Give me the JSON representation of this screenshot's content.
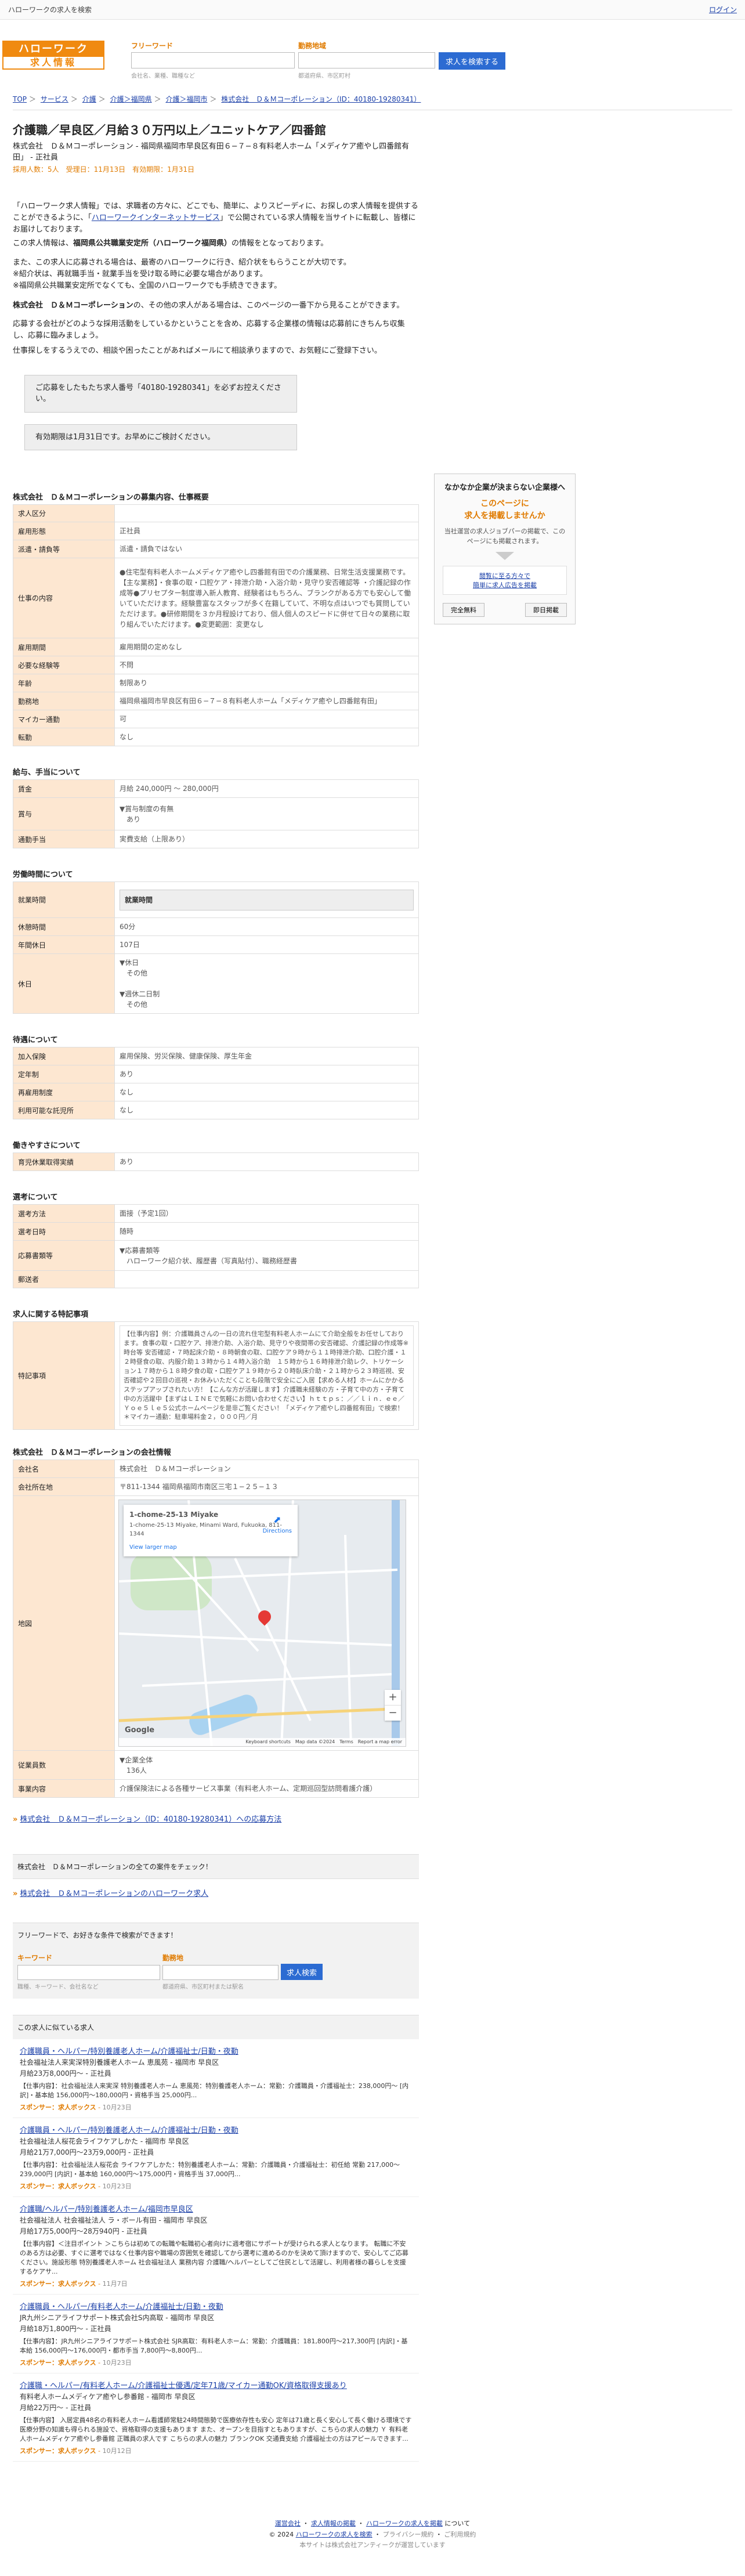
{
  "topbar": {
    "site_title": "ハローワークの求人を検索",
    "login": "ログイン"
  },
  "header": {
    "logo_line1": "ハローワーク",
    "logo_line2": "求人情報",
    "keyword_label": "フリーワード",
    "keyword_hint": "会社名、業種、職種など",
    "area_label": "勤務地域",
    "area_hint": "都道府県、市区町村",
    "search_button": "求人を検索する"
  },
  "breadcrumb": [
    "TOP",
    "サービス",
    "介護",
    "介護＞福岡県",
    "介護＞福岡市",
    "株式会社　Ｄ＆Ｍコーポレーション（ID：40180-19280341）"
  ],
  "job": {
    "title": "介護職／早良区／月給３０万円以上／ユニットケア／四番館",
    "employer_line": "株式会社　Ｄ＆Ｍコーポレーション - 福岡県福岡市早良区有田６−７−８有料老人ホーム「メディケア癒やし四番館有田」 - 正社員",
    "pubinfo": "採用人数：5人　受理日：11月13日　有効期限：1月31日"
  },
  "intro": {
    "p1_a": "「ハローワーク求人情報」では、求職者の方々に、どこでも、簡単に、よりスピーディに、お探しの求人情報を提供することができるように、「",
    "p1_link": "ハローワークインターネットサービス",
    "p1_b": "」で公開されている求人情報を当サイトに転載し、皆様にお届けしております。",
    "p2_a": "この求人情報は、",
    "p2_bold": "福岡県公共職業安定所（ハローワーク福岡県）",
    "p2_b": "の情報をとなっております。",
    "p3": "また、この求人に応募される場合は、最寄のハローワークに行き、紹介状をもらうことが大切です。",
    "p4": "※紹介状は、再就職手当・就業手当を受け取る時に必要な場合があります。",
    "p5": "※福岡県公共職業安定所でなくても、全国のハローワークでも手続きできます。",
    "p6_bold": "株式会社　Ｄ＆Ｍコーポレーション",
    "p6_b": "の、その他の求人がある場合は、このページの一番下から見ることができます。",
    "p7": "応募する会社がどのような採用活動をしているかということを含め、応募する企業様の情報は応募前にきちんち収集し、応募に臨みましょう。",
    "p8": "仕事探しをするうえでの、相談や困ったことがあればメールにて相談承りますので、お気軽にご登録下さい。"
  },
  "notice1": "ご応募をしたもたち求人番号「40180-19280341」を必ずお控えください。",
  "notice2": "有効期限は1月31日です。お早めにご検討ください。",
  "sidebar": {
    "head": "なかなか企業が決まらない企業様へ",
    "orange": "このページに\n求人を掲載しませんか",
    "text": "当社運営の求人ジョブパーの掲載で、このページにも掲載されます。",
    "link": "閲覧に至る方々で\n簡単に求人広告を掲載",
    "btn1": "完全無料",
    "btn2": "即日掲載"
  },
  "sections": {
    "overview": {
      "title": "株式会社　Ｄ＆Ｍコーポレーションの募集内容、仕事概要",
      "rows": [
        {
          "k": "求人区分",
          "v": ""
        },
        {
          "k": "雇用形態",
          "v": "正社員"
        },
        {
          "k": "派遣・請負等",
          "v": "派遣・請負ではない"
        },
        {
          "k": "仕事の内容",
          "v": "●住宅型有料老人ホームメディケア癒やし四番館有田での介護業務、日常生活支援業務です。【主な業務】・食事の取・口腔ケア・排泄介助・入浴介助・見守り安否確認等 ・介護記録の作成等●プリセプター制度導入新人教育、経験者はもちろん、ブランクがある方でも安心して働いていただけます。経験豊富なスタッフが多く在籍していて、不明な点はいつでも質問していただけます。●研修期間を３か月程設けており、個人個人のスピードに併せて日々の業務に取り組んでいただけます。●変更範囲：変更なし"
        },
        {
          "k": "雇用期間",
          "v": "雇用期間の定めなし"
        },
        {
          "k": "必要な経験等",
          "v": "不問"
        },
        {
          "k": "年齢",
          "v": "制限あり"
        },
        {
          "k": "勤務地",
          "v": "福岡県福岡市早良区有田６−７−８有料老人ホーム「メディケア癒やし四番館有田」"
        },
        {
          "k": "マイカー通勤",
          "v": "可"
        },
        {
          "k": "転勤",
          "v": "なし"
        }
      ]
    },
    "salary": {
      "title": "給与、手当について",
      "rows": [
        {
          "k": "賃金",
          "v": "月給 240,000円 〜 280,000円"
        },
        {
          "k": "賞与",
          "v": "▼賞与制度の有無\n　あり"
        },
        {
          "k": "通勤手当",
          "v": "実費支給（上限あり）"
        }
      ]
    },
    "conditions": {
      "title": "労働時間について",
      "rows": [
        {
          "k": "就業時間",
          "v": "就業時間"
        },
        {
          "k": "休憩時間",
          "v": "60分"
        },
        {
          "k": "年間休日",
          "v": "107日"
        },
        {
          "k": "休日",
          "v": "▼休日\n　その他\n\n▼週休二日制\n　その他"
        }
      ]
    },
    "benefits": {
      "title": "待遇について",
      "rows": [
        {
          "k": "加入保険",
          "v": "雇用保険、労災保険、健康保険、厚生年金"
        },
        {
          "k": "定年制",
          "v": "あり"
        },
        {
          "k": "再雇用制度",
          "v": "なし"
        },
        {
          "k": "利用可能な託児所",
          "v": "なし"
        }
      ]
    },
    "ease": {
      "title": "働きやすさについて",
      "rows": [
        {
          "k": "育児休業取得実績",
          "v": "あり"
        }
      ]
    },
    "selection": {
      "title": "選考について",
      "rows": [
        {
          "k": "選考方法",
          "v": "面接（予定1回）"
        },
        {
          "k": "選考日時",
          "v": "随時"
        },
        {
          "k": "応募書類等",
          "v": "▼応募書類等\n　ハローワーク紹介状、履歴書（写真貼付）、職務経歴書"
        },
        {
          "k": "郵送者",
          "v": ""
        }
      ]
    },
    "notes": {
      "title": "求人に関する特記事項",
      "k": "特記事項",
      "v": "【仕事内容】例：介護職員さんの一日の流れ住宅型有料老人ホームにて介助全般をお任せしております。食事の取・口腔ケア、排泄介助、入浴介助、見守りや夜間帯の安否確認、介護記録の作成等※時台等 安否確認・７時起床介助・８時朝食の取、口腔ケア９時から１１時排泄介助、口腔介護・１２時昼食の取、内服介助１３時から１４時入浴介助　１５時から１６時排泄介助レク、トリケーション１７時から１８時夕食の取・口腔ケア１９時から２０時臥床介助・２１時から２３時巡視、安否確認や２回目の巡視・お休みいただくことも段階で安全にご入居【求める人材】ホームにかかるステップアップされたい方！【こんな方が活躍します】介護職未経験の方・子育て中の方・子育て中の方活躍中【まずはＬＩＮＥで気軽にお問い合わせください】ｈｔｔｐｓ：／／ｌｉｎ．ｅｅ／Ｙｏｅ５ｌｅ５公式ホームページを是非ご覧ください！「メディケア癒やし四番館有田」で検索！＊マイカー通勤：駐車場料金２，０００円／月"
    },
    "company": {
      "title": "株式会社　Ｄ＆Ｍコーポレーションの会社情報",
      "rows": [
        {
          "k": "会社名",
          "v": "株式会社　Ｄ＆Ｍコーポレーション"
        },
        {
          "k": "会社所在地",
          "v": "〒811-1344 福岡県福岡市南区三宅１−２５−１３"
        }
      ],
      "map_row": "地図",
      "employees_k": "従業員数",
      "employees_v": "▼企業全体\n　136人",
      "biz_k": "事業内容",
      "biz_v": "介護保険法による各種サービス事業（有料老人ホーム、定期巡回型訪問看護介護）"
    }
  },
  "map": {
    "place_title": "1-chome-25-13 Miyake",
    "place_addr": "1-chome-25-13 Miyake, Minami Ward, Fukuoka, 811-1344",
    "directions": "Directions",
    "larger_map": "View larger map",
    "google": "Google",
    "footer": "Keyboard shortcuts　Map data ©2024　Terms　Report a map error"
  },
  "links": {
    "apply": "株式会社　Ｄ＆Ｍコーポレーション（ID：40180-19280341）への応募方法",
    "check_all": "株式会社　Ｄ＆Ｍコーポレーションの全ての案件をチェック！",
    "hw_jobs": "株式会社　Ｄ＆Ｍコーポレーションのハローワーク求人"
  },
  "freesearch": {
    "head": "フリーワードで、お好きな条件で検索ができます！",
    "kw_label": "キーワード",
    "kw_hint": "職種、キーワード、会社名など",
    "area_label": "勤務地",
    "area_hint": "都道府県、市区町村または駅名",
    "button": "求人検索"
  },
  "recommend": {
    "head": "この求人に似ている求人",
    "sponsor_label": "スポンサー：求人ボックス",
    "items": [
      {
        "title": "介護職員・ヘルパー/特別養護老人ホーム/介護福祉士/日勤・夜勤",
        "company": "社会福祉法人来実深特別養護老人ホーム 恵風苑 - 福岡市 早良区",
        "salary": "月給23万8,000円〜 - 正社員",
        "desc": "【仕事内容】：社会福祉法人来実深 特別養護老人ホーム 恵風苑：特別養護老人ホーム：常勤：介護職員・介護福祉士：238,000円〜 [内訳]・基本給 156,000円〜180,000円・資格手当 25,000円...",
        "date": "10月23日"
      },
      {
        "title": "介護職員・ヘルパー/特別養護老人ホーム/介護福祉士/日勤・夜勤",
        "company": "社会福祉法人桜花会ライフケアしかた - 福岡市 早良区",
        "salary": "月給21万7,000円〜23万9,000円 - 正社員",
        "desc": "【仕事内容】：社会福祉法人桜花会 ライフケアしかた：特別養護老人ホーム：常勤：介護職員・介護福祉士：初任給 常勤 217,000〜239,000円 [内訳]・基本給 160,000円〜175,000円・資格手当 37,000円...",
        "date": "10月23日"
      },
      {
        "title": "介護職/ヘルパー/特別養護老人ホーム/福岡市早良区",
        "company": "社会福祉法人 社会福祉法人 ラ・ボール有田 - 福岡市 早良区",
        "salary": "月給17万5,000円〜28万940円 - 正社員",
        "desc": "【仕事内容】＜注目ポイント ＞こちらは初めての転職や転職初心者向けに週考宿にサポートが受けられる求人となります。 転職に不安のある方は必要、すぐに選考ではなく仕事内容や職場の雰囲気を確認してから選考に進めるのかを決めて頂けますので、安心してご応募ください。施設形態 特別養護老人ホーム 社会福祉法人 業務内容 介護職/ヘルパーとしてご住民として活躍し、利用者様の暮らしを支援するケアサ...",
        "date": "11月7日"
      },
      {
        "title": "介護職員・ヘルパー/有料老人ホーム/介護福祉士/日勤・夜勤",
        "company": "JR九州シニアライフサポート株式会社S内高取 - 福岡市 早良区",
        "salary": "月給18万1,800円〜 - 正社員",
        "desc": "【仕事内容】：JR九州シニアライフサポート株式会社 SJR高取：有料老人ホーム：常勤：介護職員：181,800円〜217,300円 [内訳]・基本給 156,000円〜176,000円・都市手当 7,800円〜8,800円...",
        "date": "10月23日"
      },
      {
        "title": "介護職・ヘルパー/有料老人ホーム/介護福祉士優遇/定年71歳/マイカー通勤OK/資格取得支援あり",
        "company": "有料老人ホームメディケア癒やし参番館 - 福岡市 早良区",
        "salary": "月給22万円〜 - 正社員",
        "desc": "【仕事内容】 入居定員48名の有料老人ホーム看護師常駐24時間態勢で医療依存性も安心 定年は71歳と長く安心して長く働ける環境です 医療分野の知識も得られる施設で、資格取得の支援もあります また、オープンを目指すともありますが、こちらの求人の魅力 Ｙ 有料老人ホームメディケア癒やし参番館 正職員の求人です こちらの求人の魅力 ブランクOK 交通費支給 介護福祉士の方はアピールできます...",
        "date": "10月12日"
      }
    ]
  },
  "footer": {
    "l1a": "運営会社",
    "l1b": "求人情報の掲載",
    "l1c": "ハローワークの求人を掲載",
    "l1d": "について",
    "l2a": "© 2024",
    "l2b": "ハローワークの求人を検索",
    "l2c": "プライバシー規約",
    "l2d": "ご利用規約",
    "l3": "本サイトは株式会社アンティークが運営しています"
  }
}
